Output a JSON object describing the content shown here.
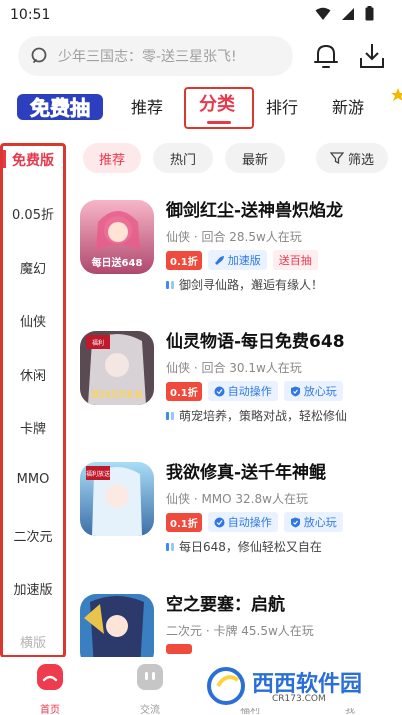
{
  "status_bar": {
    "time": "10:51"
  },
  "search": {
    "placeholder": "少年三国志：零-送三星张飞!"
  },
  "nav": {
    "logo_text": "免费抽",
    "tabs": [
      {
        "label": "推荐"
      },
      {
        "label": "分类"
      },
      {
        "label": "排行"
      },
      {
        "label": "新游"
      }
    ]
  },
  "sidebar": {
    "items": [
      {
        "label": "免费版"
      },
      {
        "label": "0.05折"
      },
      {
        "label": "魔幻"
      },
      {
        "label": "仙侠"
      },
      {
        "label": "休闲"
      },
      {
        "label": "卡牌"
      },
      {
        "label": "MMO"
      },
      {
        "label": "二次元"
      },
      {
        "label": "加速版"
      },
      {
        "label": "横版"
      }
    ]
  },
  "filters": {
    "chips": [
      {
        "label": "推荐"
      },
      {
        "label": "热门"
      },
      {
        "label": "最新"
      },
      {
        "label": "筛选"
      }
    ]
  },
  "games": [
    {
      "title": "御剑红尘-送神兽炽焰龙",
      "meta": "仙侠 · 回合  28.5w人在玩",
      "discount": "0.1折",
      "tags": [
        "加速版",
        "送百抽"
      ],
      "desc": "御剑寻仙路，邂逅有缘人！",
      "icon_badge": "每日送648"
    },
    {
      "title": "仙灵物语-每日免费648",
      "meta": "仙侠 · 回合  30.1w人在玩",
      "discount": "0.1折",
      "tags": [
        "自动操作",
        "放心玩"
      ],
      "desc": "萌宠培养，策略对战，轻松修仙",
      "icon_badge": "送10万元礼包"
    },
    {
      "title": "我欲修真-送千年神鲲",
      "meta": "仙侠 · MMO  32.8w人在玩",
      "discount": "0.1折",
      "tags": [
        "自动操作",
        "放心玩"
      ],
      "desc": "每日648，修仙轻松又自在",
      "icon_badge": "福利放送"
    },
    {
      "title": "空之要塞：启航",
      "meta": "二次元 · 卡牌  45.5w人在玩",
      "discount": "",
      "tags": [],
      "desc": "",
      "icon_badge": ""
    }
  ],
  "bottom_tabs": [
    {
      "label": "首页"
    },
    {
      "label": "交流"
    },
    {
      "label": "福利"
    },
    {
      "label": "我"
    }
  ],
  "watermark": {
    "text": "西西软件园",
    "sub": "CR173.COM"
  },
  "colors": {
    "accent": "#e8384c",
    "annotation": "#d9382e",
    "tag_blue": "#2e78e6"
  }
}
